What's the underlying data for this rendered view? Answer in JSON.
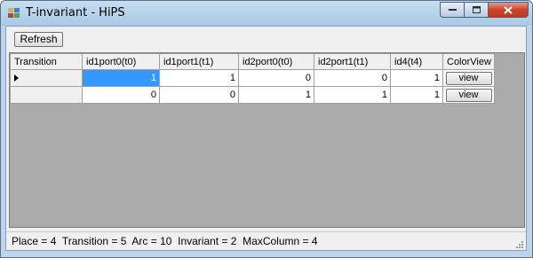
{
  "window": {
    "title": "T-invariant - HiPS"
  },
  "controls": {
    "minimize": "–",
    "maximize": "□",
    "close": "✕"
  },
  "toolbar": {
    "refresh_label": "Refresh"
  },
  "grid": {
    "columns": [
      "Transition",
      "id1port0(t0)",
      "id1port1(t1)",
      "id2port0(t0)",
      "id2port1(t1)",
      "id4(t4)",
      "ColorView"
    ],
    "rows": [
      {
        "values": [
          "1",
          "1",
          "0",
          "0",
          "1"
        ],
        "button": "view"
      },
      {
        "values": [
          "0",
          "0",
          "1",
          "1",
          "1"
        ],
        "button": "view"
      }
    ]
  },
  "status": {
    "text": "Place = 4  Transition = 5  Arc = 10  Invariant = 2  MaxColumn = 4"
  },
  "icons": {
    "app": "app-icon",
    "row_indicator": "current-row-arrow-icon",
    "grip": "resize-grip-icon"
  }
}
